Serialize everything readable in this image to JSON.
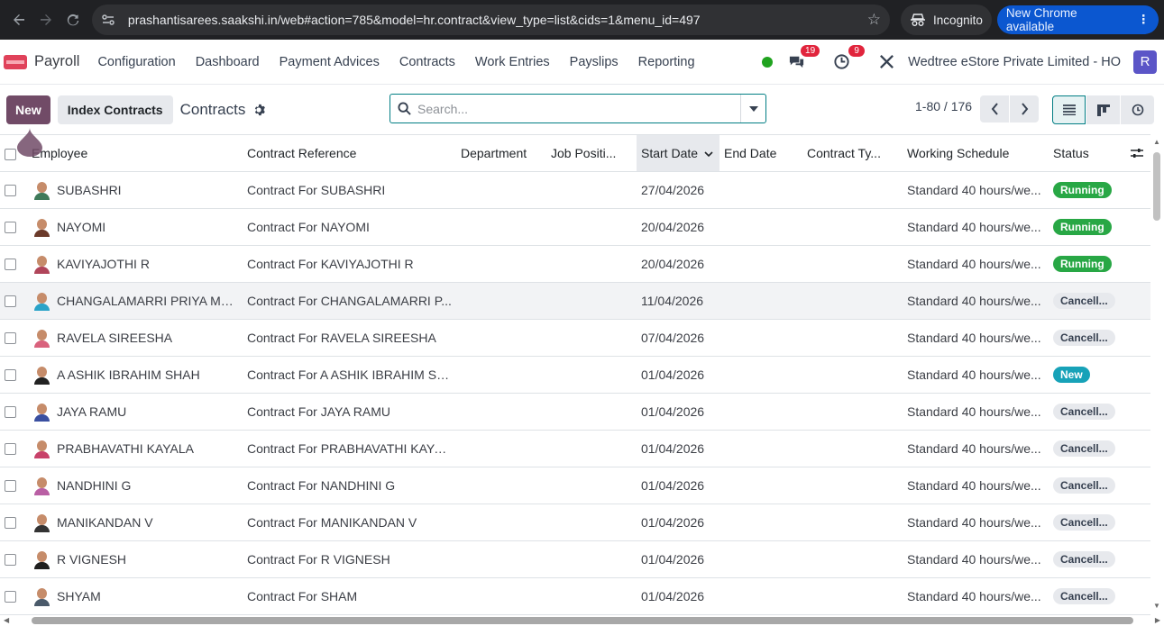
{
  "browser": {
    "url": "prashantisarees.saakshi.in/web#action=785&model=hr.contract&view_type=list&cids=1&menu_id=497",
    "incognito_label": "Incognito",
    "update_label": "New Chrome available"
  },
  "topbar": {
    "app_name": "Payroll",
    "menu": [
      "Configuration",
      "Dashboard",
      "Payment Advices",
      "Contracts",
      "Work Entries",
      "Payslips",
      "Reporting"
    ],
    "messages_count": "19",
    "activities_count": "9",
    "company": "Wedtree eStore Private Limited - HO",
    "user_initial": "R"
  },
  "control": {
    "new_label": "New",
    "index_label": "Index Contracts",
    "breadcrumb": "Contracts",
    "search_placeholder": "Search...",
    "pager": "1-80 / 176"
  },
  "table": {
    "columns": [
      "Employee",
      "Contract Reference",
      "Department",
      "Job Positi...",
      "Start Date",
      "End Date",
      "Contract Ty...",
      "Working Schedule",
      "Status"
    ],
    "rows": [
      {
        "employee": "SUBASHRI",
        "reference": "Contract For SUBASHRI",
        "start": "27/04/2026",
        "schedule": "Standard 40 hours/we...",
        "status": "Running",
        "status_kind": "running",
        "shirt": "#3f7a5a"
      },
      {
        "employee": "NAYOMI",
        "reference": "Contract For NAYOMI",
        "start": "20/04/2026",
        "schedule": "Standard 40 hours/we...",
        "status": "Running",
        "status_kind": "running",
        "shirt": "#6b3a2a"
      },
      {
        "employee": "KAVIYAJOTHI R",
        "reference": "Contract For KAVIYAJOTHI R",
        "start": "20/04/2026",
        "schedule": "Standard 40 hours/we...",
        "status": "Running",
        "status_kind": "running",
        "shirt": "#b0455a"
      },
      {
        "employee": "CHANGALAMARRI PRIYA MA...",
        "reference": "Contract For CHANGALAMARRI P...",
        "start": "11/04/2026",
        "schedule": "Standard 40 hours/we...",
        "status": "Cancell...",
        "status_kind": "cancel",
        "shirt": "#2aa3c8"
      },
      {
        "employee": "RAVELA SIREESHA",
        "reference": "Contract For RAVELA SIREESHA",
        "start": "07/04/2026",
        "schedule": "Standard 40 hours/we...",
        "status": "Cancell...",
        "status_kind": "cancel",
        "shirt": "#d9627d"
      },
      {
        "employee": "A ASHIK IBRAHIM SHAH",
        "reference": "Contract For A ASHIK IBRAHIM SH...",
        "start": "01/04/2026",
        "schedule": "Standard 40 hours/we...",
        "status": "New",
        "status_kind": "new",
        "shirt": "#222222"
      },
      {
        "employee": "JAYA RAMU",
        "reference": "Contract For JAYA RAMU",
        "start": "01/04/2026",
        "schedule": "Standard 40 hours/we...",
        "status": "Cancell...",
        "status_kind": "cancel",
        "shirt": "#3a4fa0"
      },
      {
        "employee": "PRABHAVATHI KAYALA",
        "reference": "Contract For PRABHAVATHI KAYALA",
        "start": "01/04/2026",
        "schedule": "Standard 40 hours/we...",
        "status": "Cancell...",
        "status_kind": "cancel",
        "shirt": "#c8426a"
      },
      {
        "employee": "NANDHINI G",
        "reference": "Contract For NANDHINI G",
        "start": "01/04/2026",
        "schedule": "Standard 40 hours/we...",
        "status": "Cancell...",
        "status_kind": "cancel",
        "shirt": "#b95fa4"
      },
      {
        "employee": "MANIKANDAN V",
        "reference": "Contract For MANIKANDAN V",
        "start": "01/04/2026",
        "schedule": "Standard 40 hours/we...",
        "status": "Cancell...",
        "status_kind": "cancel",
        "shirt": "#333333"
      },
      {
        "employee": "R VIGNESH",
        "reference": "Contract For R VIGNESH",
        "start": "01/04/2026",
        "schedule": "Standard 40 hours/we...",
        "status": "Cancell...",
        "status_kind": "cancel",
        "shirt": "#1f1f1f"
      },
      {
        "employee": "SHYAM",
        "reference": "Contract For SHAM",
        "start": "01/04/2026",
        "schedule": "Standard 40 hours/we...",
        "status": "Cancell...",
        "status_kind": "cancel",
        "shirt": "#4a5a6a"
      }
    ]
  },
  "colors": {
    "brand": "#714b67",
    "accent": "#017e84",
    "running": "#28a745",
    "new": "#17a2b8"
  }
}
